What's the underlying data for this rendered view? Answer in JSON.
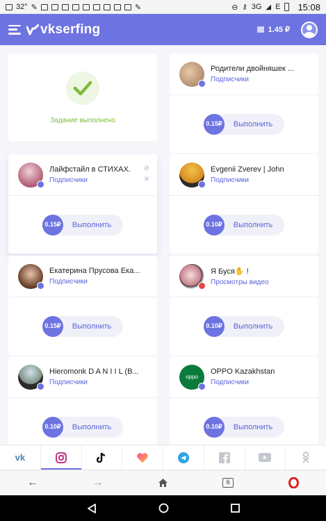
{
  "status_bar": {
    "left_text": [
      "32°"
    ],
    "right_text": [
      "3G",
      "E"
    ],
    "time": "15:08"
  },
  "header": {
    "logo_text": "vkserfing",
    "balance": "1.45 ₽",
    "brand_color": "#6d73e0"
  },
  "done_card": {
    "text": "Задание выполнено"
  },
  "tasks": [
    {
      "name": "Родители двойняшек ...",
      "kind": "Подписчики",
      "price": "0.15₽",
      "button": "Выполнить"
    },
    {
      "name": "Лайфстайл в СТИХАХ.",
      "kind": "Подписчики",
      "price": "0.15₽",
      "button": "Выполнить"
    },
    {
      "name": "Evgenii Zverev | John",
      "kind": "Подписчики",
      "price": "0.10₽",
      "button": "Выполнить"
    },
    {
      "name": "Екатерина Прусова Ека...",
      "kind": "Подписчики",
      "price": "0.15₽",
      "button": "Выполнить"
    },
    {
      "name": "Я Буся✋ !",
      "kind": "Просмотры видео",
      "price": "0.10₽",
      "button": "Выполнить"
    },
    {
      "name": "Hieromonk D A N I I L (B...",
      "kind": "Подписчики",
      "price": "0.10₽",
      "button": "Выполнить"
    },
    {
      "name": "OPPO Kazakhstan",
      "kind": "Подписчики",
      "price": "0.10₽",
      "button": "Выполнить"
    }
  ],
  "oppo_logo_text": "oppo",
  "social_tabs": [
    "vk-icon",
    "instagram-icon",
    "tiktok-icon",
    "likee-icon",
    "telegram-icon",
    "facebook-icon",
    "youtube-icon",
    "odnoklassniki-icon"
  ],
  "active_social_tab": "instagram-icon",
  "browser": {
    "tab_count": "6"
  },
  "colors": {
    "accent": "#6d73e0",
    "success": "#7dbb3c",
    "opera": "#e0201d"
  }
}
